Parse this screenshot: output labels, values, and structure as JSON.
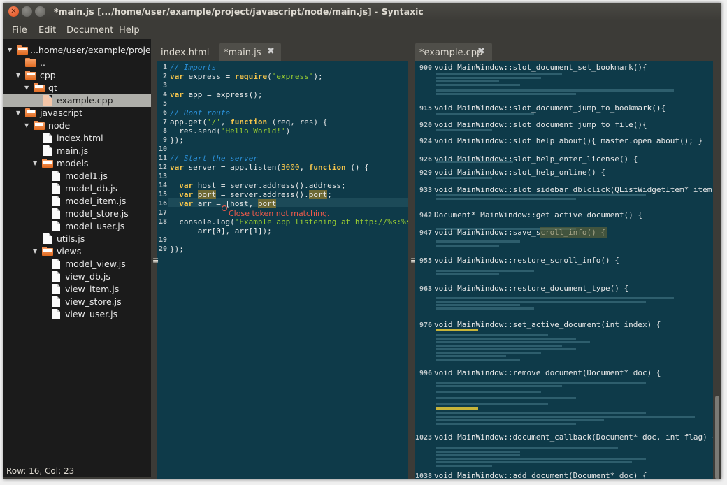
{
  "window": {
    "title": "*main.js [.../home/user/example/project/javascript/node/main.js] - Syntaxic"
  },
  "menu": [
    "File",
    "Edit",
    "Document",
    "Help"
  ],
  "tree": [
    {
      "label": "...home/user/example/project",
      "type": "folder",
      "expanded": true
    },
    {
      "label": "..",
      "type": "folder"
    },
    {
      "label": "cpp",
      "type": "folder",
      "expanded": true
    },
    {
      "label": "qt",
      "type": "folder",
      "expanded": true
    },
    {
      "label": "example.cpp",
      "type": "file",
      "selected": true
    },
    {
      "label": "javascript",
      "type": "folder",
      "expanded": true
    },
    {
      "label": "node",
      "type": "folder",
      "expanded": true
    },
    {
      "label": "index.html",
      "type": "file"
    },
    {
      "label": "main.js",
      "type": "file"
    },
    {
      "label": "models",
      "type": "folder",
      "expanded": true
    },
    {
      "label": "model1.js",
      "type": "file"
    },
    {
      "label": "model_db.js",
      "type": "file"
    },
    {
      "label": "model_item.js",
      "type": "file"
    },
    {
      "label": "model_store.js",
      "type": "file"
    },
    {
      "label": "model_user.js",
      "type": "file"
    },
    {
      "label": "utils.js",
      "type": "file"
    },
    {
      "label": "views",
      "type": "folder",
      "expanded": true
    },
    {
      "label": "model_view.js",
      "type": "file"
    },
    {
      "label": "view_db.js",
      "type": "file"
    },
    {
      "label": "view_item.js",
      "type": "file"
    },
    {
      "label": "view_store.js",
      "type": "file"
    },
    {
      "label": "view_user.js",
      "type": "file"
    }
  ],
  "status": "Row: 16, Col: 23",
  "left_tabs": [
    "index.html",
    "*main.js"
  ],
  "right_tabs": [
    "*example.cpp"
  ],
  "error_text": "Close token not matching.",
  "code_lines": [
    "1",
    "2",
    "3",
    "4",
    "5",
    "6",
    "7",
    "8",
    "9",
    "10",
    "11",
    "12",
    "13",
    "14",
    "15",
    "16",
    "17",
    "18",
    "19",
    "20"
  ],
  "code_text": {
    "l1": "// Imports",
    "l2a": "var",
    "l2b": " express = ",
    "l2c": "require",
    "l2d": "(",
    "l2e": "'express'",
    "l2f": ");",
    "l4a": "var",
    "l4b": " app = express();",
    "l6": "// Root route",
    "l7a": "app.get(",
    "l7b": "'/'",
    "l7c": ", ",
    "l7d": "function",
    "l7e": " (req, res) {",
    "l8a": "  res.send(",
    "l8b": "'Hello World!'",
    "l8c": ")",
    "l9": "});",
    "l11": "// Start the server",
    "l12a": "var",
    "l12b": " server = app.listen(",
    "l12c": "3000",
    "l12d": ", ",
    "l12e": "function",
    "l12f": " () {",
    "l14a": "  ",
    "l14b": "var",
    "l14c": " host = server.address().address;",
    "l15a": "  ",
    "l15b": "var",
    "l15c": " ",
    "l15d": "port",
    "l15e": " = server.address().",
    "l15f": "port",
    "l15g": ";",
    "l16a": "  ",
    "l16b": "var",
    "l16c": " arr = [host, ",
    "l16d": "port",
    "l18a": "  console.log(",
    "l18b": "'Example app listening at http://%s:%s'",
    "l18c": ",",
    "l18w": "      arr[0], arr[1]);",
    "l20": "});"
  },
  "outline": [
    {
      "ln": "900",
      "text": "void MainWindow::slot_document_set_bookmark(){"
    },
    {
      "ln": "915",
      "text": "void MainWindow::slot_document_jump_to_bookmark(){"
    },
    {
      "ln": "920",
      "text": "void MainWindow::slot_document_jump_to_file(){"
    },
    {
      "ln": "924",
      "text": "void MainWindow::slot_help_about(){ master.open_about(); }"
    },
    {
      "ln": "926",
      "text": "void MainWindow::slot_help_enter_license() {"
    },
    {
      "ln": "929",
      "text": "void MainWindow::slot_help_online() {"
    },
    {
      "ln": "933",
      "text": "void MainWindow::slot_sidebar_dblclick(QListWidgetItem* item) {"
    },
    {
      "ln": "942",
      "text": "Document* MainWindow::get_active_document() {"
    },
    {
      "ln": "947",
      "text": "void MainWindow::save_scroll_info() {"
    },
    {
      "ln": "955",
      "text": "void MainWindow::restore_scroll_info() {"
    },
    {
      "ln": "963",
      "text": "void MainWindow::restore_document_type() {"
    },
    {
      "ln": "976",
      "text": "void MainWindow::set_active_document(int index) {"
    },
    {
      "ln": "996",
      "text": "void MainWindow::remove_document(Document* doc) {"
    },
    {
      "ln": "1023",
      "text": "void MainWindow::document_callback(Document* doc, int flag) {"
    },
    {
      "ln": "1038",
      "text": "void MainWindow::add_document(Document* doc) {"
    }
  ]
}
